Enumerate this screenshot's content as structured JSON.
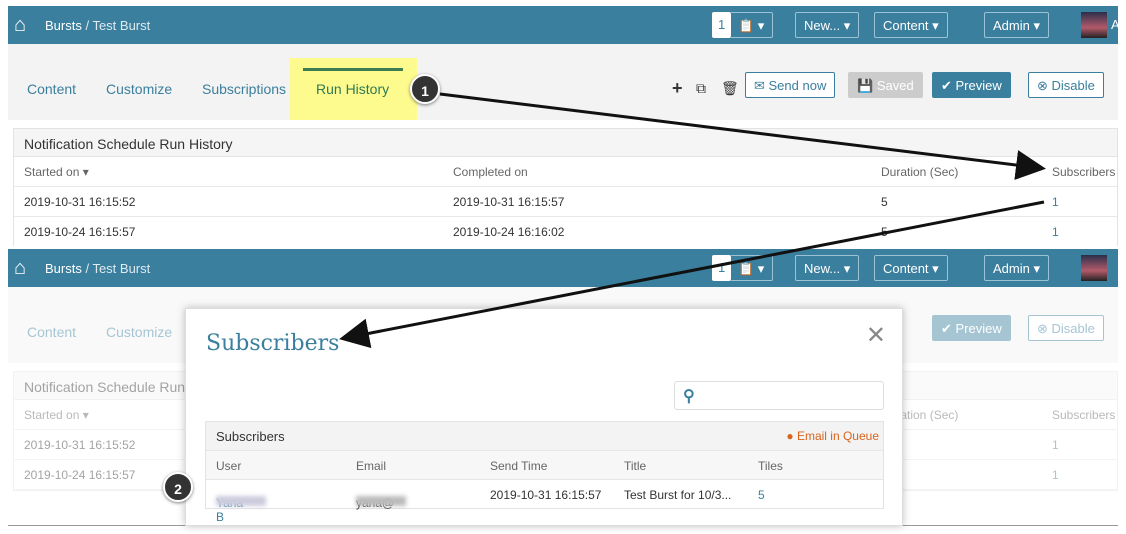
{
  "header": {
    "section": "Bursts",
    "sep": " / ",
    "page": "Test Burst",
    "counter": "1",
    "new": "New... ▾",
    "content": "Content ▾",
    "admin": "Admin ▾",
    "avatar_initial": "A"
  },
  "tabs": [
    "Content",
    "Customize",
    "Subscriptions",
    "Run History"
  ],
  "toolbar": {
    "send_now": "Send now",
    "saved": "Saved",
    "preview": "Preview",
    "disable": "Disable"
  },
  "run_history": {
    "title": "Notification Schedule Run History",
    "columns": [
      "Started on ▾",
      "Completed on",
      "Duration (Sec)",
      "Subscribers"
    ],
    "rows": [
      [
        "2019-10-31 16:15:52",
        "2019-10-31 16:15:57",
        "5",
        "1"
      ],
      [
        "2019-10-24 16:15:57",
        "2019-10-24 16:16:02",
        "5",
        "1"
      ]
    ]
  },
  "modal": {
    "title": "Subscribers",
    "close": "✕",
    "table_title": "Subscribers",
    "queue_label": "Email in Queue",
    "columns": [
      "User",
      "Email",
      "Send Time",
      "Title",
      "Tiles"
    ],
    "row": {
      "user": "Yana B",
      "email": "yana@",
      "send_time": "2019-10-31 16:15:57",
      "title": "Test Burst for 10/3...",
      "tiles": "5"
    }
  },
  "annotations": {
    "step1": "1",
    "step2": "2"
  },
  "colors": {
    "brand": "#3a7f9e",
    "highlight": "#fdfa8e",
    "queue": "#d9641c"
  }
}
